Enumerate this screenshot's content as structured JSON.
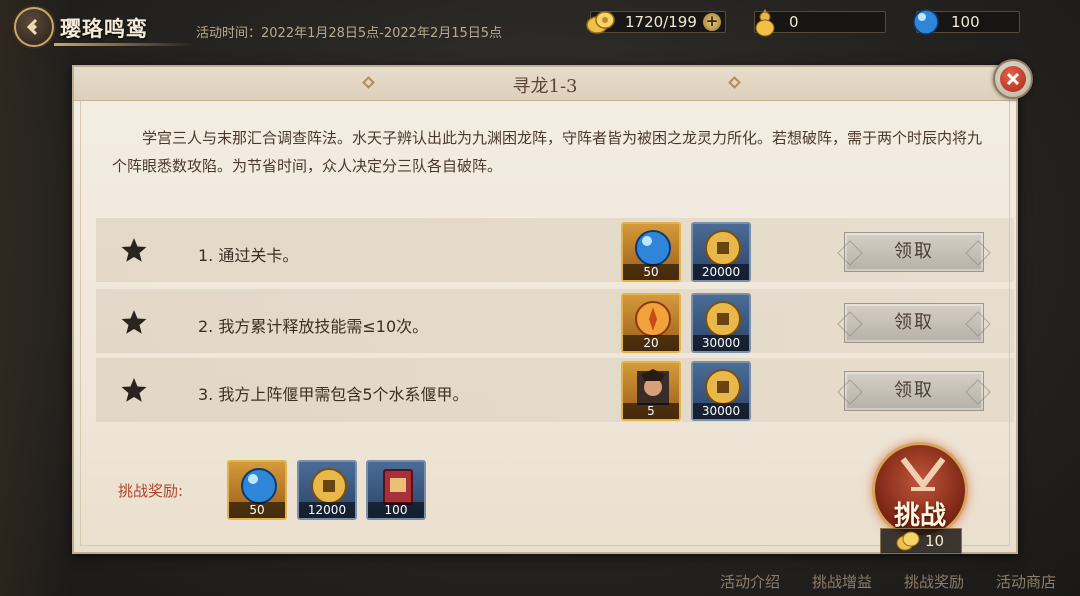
{
  "header": {
    "event_title": "璎珞鸣鸾",
    "event_time": "活动时间：2022年1月28日5点-2022年2月15日5点",
    "resources": [
      {
        "name": "gold-ticket",
        "value": "1720/199"
      },
      {
        "name": "gourd",
        "value": "0"
      },
      {
        "name": "orb",
        "value": "100"
      }
    ]
  },
  "panel": {
    "title": "寻龙1-3",
    "story": "学宫三人与末那汇合调查阵法。水天子辨认出此为九渊困龙阵，守阵者皆为被困之龙灵力所化。若想破阵，需于两个时辰内将九个阵眼悉数攻陷。为节省时间，众人决定分三队各自破阵。",
    "claim_label": "领取",
    "tasks": [
      {
        "label": "1. 通过关卡。",
        "rewards": [
          {
            "icon": "blue-orb-icon",
            "count": "50"
          },
          {
            "icon": "copper-coin-icon",
            "count": "20000"
          }
        ]
      },
      {
        "label": "2. 我方累计释放技能需≤10次。",
        "rewards": [
          {
            "icon": "gold-token-icon",
            "count": "20"
          },
          {
            "icon": "copper-coin-icon",
            "count": "30000"
          }
        ]
      },
      {
        "label": "3. 我方上阵偃甲需包含5个水系偃甲。",
        "rewards": [
          {
            "icon": "character-fragment-icon",
            "count": "5"
          },
          {
            "icon": "copper-coin-icon",
            "count": "30000"
          }
        ]
      }
    ],
    "challenge_rewards_label": "挑战奖励:",
    "challenge_rewards": [
      {
        "icon": "blue-orb-icon",
        "count": "50"
      },
      {
        "icon": "copper-coin-icon",
        "count": "12000"
      },
      {
        "icon": "exp-book-icon",
        "count": "100"
      }
    ],
    "challenge_button": "挑战",
    "challenge_cost": "10"
  },
  "bottom_nav": [
    "活动介绍",
    "挑战增益",
    "挑战奖励",
    "活动商店"
  ]
}
